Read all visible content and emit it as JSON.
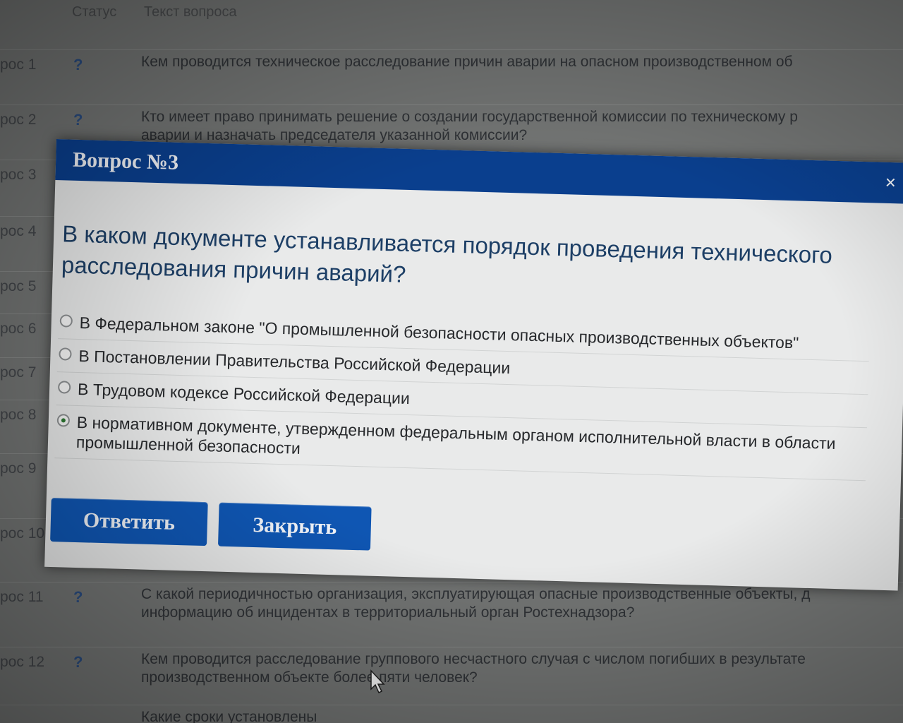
{
  "background_list": {
    "header": {
      "status_col": "Статус",
      "text_col": "Текст вопроса"
    },
    "rows": [
      {
        "num": "рос 1",
        "status": "?",
        "lines": [
          "Кем проводится техническое расследование причин аварии на опасном производственном об"
        ]
      },
      {
        "num": "рос 2",
        "status": "?",
        "lines": [
          "Кто имеет право принимать решение о создании государственной комиссии по техническому р",
          "аварии и назначать председателя указанной комиссии?"
        ]
      },
      {
        "num": "рос 3",
        "status": "",
        "lines": []
      },
      {
        "num": "рос 4",
        "status": "",
        "lines": []
      },
      {
        "num": "рос 5",
        "status": "",
        "lines": []
      },
      {
        "num": "рос 6",
        "status": "",
        "lines": []
      },
      {
        "num": "рос 7",
        "status": "",
        "lines": []
      },
      {
        "num": "рос 8",
        "status": "",
        "lines": []
      },
      {
        "num": "рос 9",
        "status": "",
        "lines": []
      },
      {
        "num": "рос 10",
        "status": "",
        "lines": []
      },
      {
        "num": "рос 11",
        "status": "?",
        "lines": [
          "С какой периодичностью организация, эксплуатирующая опасные производственные объекты, д",
          "информацию об инцидентах в территориальный орган Ростехнадзора?"
        ]
      },
      {
        "num": "рос 12",
        "status": "?",
        "lines": [
          "Кем проводится расследование группового несчастного случая с числом погибших в результате",
          "производственном объекте более пяти человек?"
        ]
      },
      {
        "num": "",
        "status": "",
        "lines": [
          "Какие сроки установлены"
        ]
      }
    ]
  },
  "modal": {
    "title": "Вопрос №3",
    "close_icon": "×",
    "question": "В каком документе устанавливается порядок проведения технического расследования причин аварий?",
    "options": [
      {
        "label": "В Федеральном законе \"О промышленной безопасности опасных производственных объектов\"",
        "checked": false
      },
      {
        "label": "В Постановлении Правительства Российской Федерации",
        "checked": false
      },
      {
        "label": "В Трудовом кодексе Российской Федерации",
        "checked": false
      },
      {
        "label": "В нормативном документе, утвержденном федеральным органом исполнительной власти в области промышленной безопасности",
        "checked": true
      }
    ],
    "buttons": {
      "answer": "Ответить",
      "close": "Закрыть"
    }
  },
  "colors": {
    "header_blue": "#0a3f8e",
    "button_blue": "#0f56b3",
    "question_text": "#1d3f66"
  }
}
